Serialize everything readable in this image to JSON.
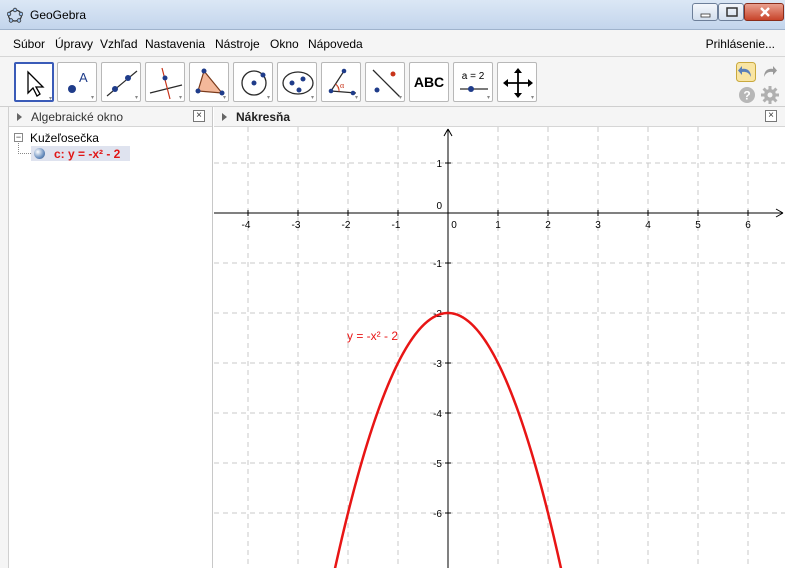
{
  "window": {
    "title": "GeoGebra"
  },
  "menu": {
    "items": [
      "Súbor",
      "Úpravy",
      "Vzhľad",
      "Nastavenia",
      "Nástroje",
      "Okno",
      "Nápoveda"
    ],
    "sign_in": "Prihlásenie..."
  },
  "toolbar": {
    "tools": [
      {
        "name": "move-tool",
        "icon": "cursor-arrow-icon",
        "selected": true
      },
      {
        "name": "point-tool",
        "icon": "point-a-icon"
      },
      {
        "name": "line-tool",
        "icon": "line-through-points-icon"
      },
      {
        "name": "perpendicular-tool",
        "icon": "perpendicular-line-icon"
      },
      {
        "name": "polygon-tool",
        "icon": "polygon-icon"
      },
      {
        "name": "circle-tool",
        "icon": "circle-icon"
      },
      {
        "name": "ellipse-tool",
        "icon": "ellipse-icon"
      },
      {
        "name": "angle-tool",
        "icon": "angle-icon"
      },
      {
        "name": "reflect-tool",
        "icon": "reflect-about-line-icon"
      },
      {
        "name": "text-tool",
        "icon": "text-icon",
        "label": "ABC"
      },
      {
        "name": "slider-tool",
        "icon": "slider-icon",
        "label": "a = 2"
      },
      {
        "name": "move-graphics-tool",
        "icon": "move-graphics-view-icon"
      }
    ],
    "undo_icon": "undo-icon",
    "redo_icon": "redo-icon",
    "help_icon": "help-icon",
    "settings_icon": "gear-icon"
  },
  "algebra": {
    "title": "Algebraické okno",
    "group": "Kužeľosečka",
    "object": "c: y = -x² - 2"
  },
  "graphics": {
    "title": "Nákresňa",
    "curve_label": "y = -x² - 2",
    "curve_color": "#e81515",
    "x_ticks": [
      "-4",
      "-3",
      "-2",
      "-1",
      "0",
      "1",
      "2",
      "3",
      "4",
      "5",
      "6"
    ],
    "y_ticks": [
      "1",
      "-1",
      "-2",
      "-3",
      "-4",
      "-5",
      "-6"
    ],
    "x_range": [
      -4.7,
      6.7
    ],
    "y_range": [
      -6.99,
      1.7
    ],
    "grid": true,
    "function": "y = -x^2 - 2"
  }
}
